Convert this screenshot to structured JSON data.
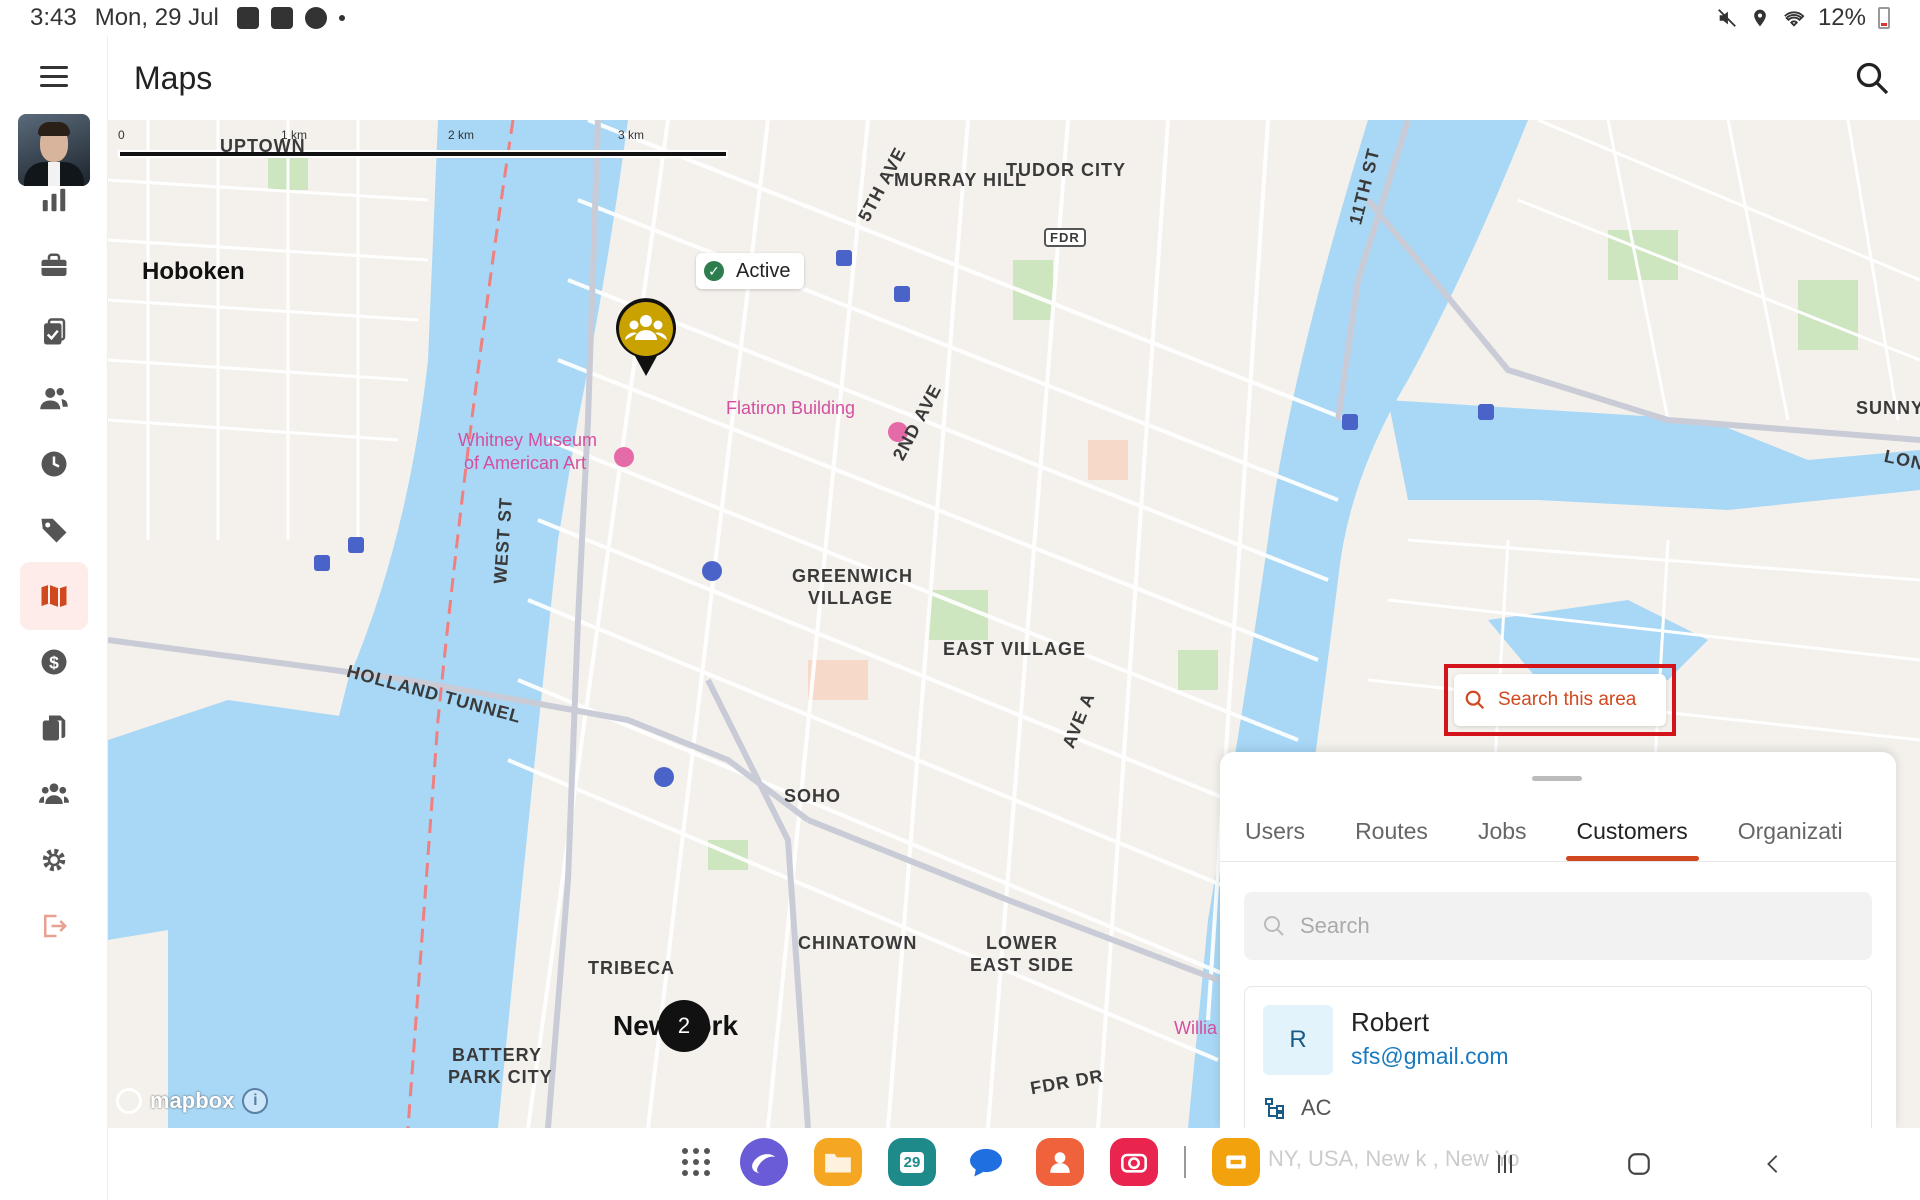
{
  "status_bar": {
    "time": "3:43",
    "date": "Mon, 29 Jul",
    "battery": "12%"
  },
  "app": {
    "title": "Maps"
  },
  "sidebar": {
    "items": [
      {
        "icon": "bar-chart-icon"
      },
      {
        "icon": "briefcase-icon"
      },
      {
        "icon": "clipboard-check-icon"
      },
      {
        "icon": "users-icon"
      },
      {
        "icon": "clock-icon"
      },
      {
        "icon": "tag-icon"
      },
      {
        "icon": "map-icon",
        "active": true
      },
      {
        "icon": "dollar-icon"
      },
      {
        "icon": "documents-icon"
      },
      {
        "icon": "team-icon"
      },
      {
        "icon": "settings-icon"
      },
      {
        "icon": "logout-icon"
      }
    ],
    "active_color": "#d1481f"
  },
  "map": {
    "scale": {
      "labels": [
        "0",
        "1 km",
        "2 km",
        "3 km"
      ]
    },
    "labels": {
      "uptown": "UPTOWN",
      "hoboken": "Hoboken",
      "murray_hill": "MURRAY HILL",
      "tudor_city": "TUDOR CITY",
      "fifth_ave": "5TH AVE",
      "eleventh_st": "11TH ST",
      "fdr": "FDR",
      "sunny": "SUNNY",
      "lon": "LON",
      "flatiron": "Flatiron Building",
      "whitney_1": "Whitney Museum",
      "whitney_2": "of American Art",
      "second_ave": "2ND AVE",
      "west_st": "WEST ST",
      "greenwich_1": "GREENWICH",
      "greenwich_2": "VILLAGE",
      "east_village": "EAST VILLAGE",
      "holland_tunnel": "HOLLAND TUNNEL",
      "ave_a": "AVE A",
      "soho": "SOHO",
      "chinatown": "CHINATOWN",
      "lower_east_1": "LOWER",
      "lower_east_2": "EAST SIDE",
      "tribeca": "TRIBECA",
      "new_york": "New York",
      "battery_1": "BATTERY",
      "battery_2": "PARK CITY",
      "fdr_dr": "FDR DR",
      "williams": "Willia",
      "mapbox": "mapbox"
    },
    "marker_status": "Active",
    "cluster_count": "2",
    "search_area_label": "Search this area",
    "colors": {
      "water": "#a8d8f6",
      "land": "#f4f1ec",
      "park": "#cde6c0",
      "road": "#ffffff",
      "accent": "#d1481f",
      "marker": "#c9a200"
    }
  },
  "sheet": {
    "tabs": [
      {
        "label": "Users"
      },
      {
        "label": "Routes"
      },
      {
        "label": "Jobs"
      },
      {
        "label": "Customers",
        "active": true
      },
      {
        "label": "Organizati"
      }
    ],
    "search_placeholder": "Search",
    "customer": {
      "initial": "R",
      "name": "Robert",
      "email": "sfs@gmail.com",
      "org": "AC",
      "address_faded": "NY, USA, New    k , New Yo"
    }
  },
  "taskbar": {
    "apps": [
      {
        "icon": "internet-icon",
        "color": "#6a5cd6"
      },
      {
        "icon": "files-icon",
        "color": "#f5a623"
      },
      {
        "icon": "calendar-icon",
        "color": "#1e8a8a",
        "text": "29"
      },
      {
        "icon": "messages-icon",
        "color": "#1f6fe0"
      },
      {
        "icon": "contacts-icon",
        "color": "#f0623c"
      },
      {
        "icon": "camera-icon",
        "color": "#e8244f"
      },
      {
        "icon": "app-icon",
        "color": "#f2a20c"
      }
    ]
  }
}
